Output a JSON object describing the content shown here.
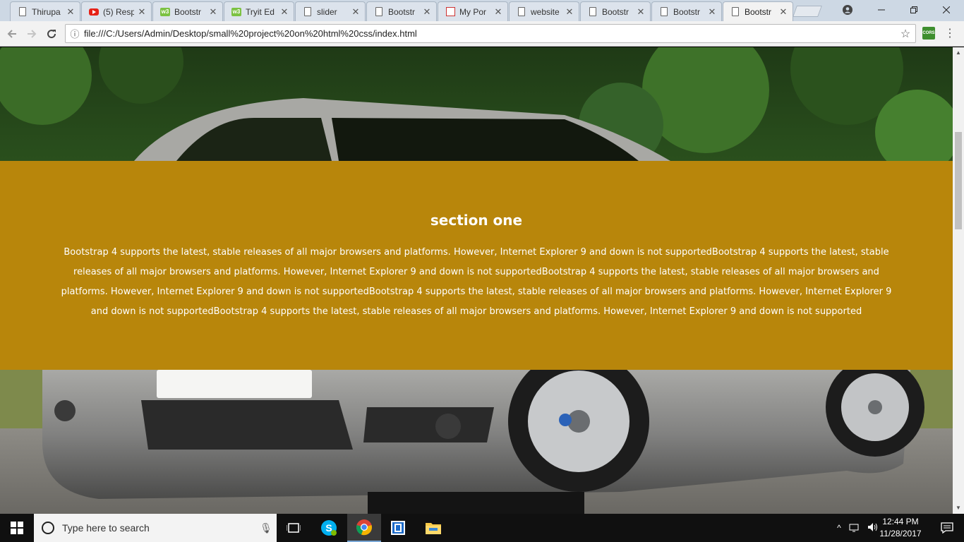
{
  "browser": {
    "tabs": [
      {
        "title": "Thirupa",
        "favicon": "doc-icon"
      },
      {
        "title": "(5) Resp",
        "favicon": "youtube-icon"
      },
      {
        "title": "Bootstr",
        "favicon": "w3-icon"
      },
      {
        "title": "Tryit Ed",
        "favicon": "w3-icon"
      },
      {
        "title": "slider",
        "favicon": "doc-icon"
      },
      {
        "title": "Bootstr",
        "favicon": "doc-icon"
      },
      {
        "title": "My Por",
        "favicon": "portfolio-icon"
      },
      {
        "title": "website",
        "favicon": "doc-icon"
      },
      {
        "title": "Bootstr",
        "favicon": "doc-icon"
      },
      {
        "title": "Bootstr",
        "favicon": "doc-icon"
      },
      {
        "title": "Bootstr",
        "favicon": "doc-icon",
        "active": true
      }
    ],
    "url": "file:///C:/Users/Admin/Desktop/small%20project%20on%20html%20css/index.html",
    "extension_label": "CORS"
  },
  "page": {
    "section_title": "section one",
    "section_text": "Bootstrap 4 supports the latest, stable releases of all major browsers and platforms. However, Internet Explorer 9 and down is not supportedBootstrap 4 supports the latest, stable releases of all major browsers and platforms. However, Internet Explorer 9 and down is not supportedBootstrap 4 supports the latest, stable releases of all major browsers and platforms. However, Internet Explorer 9 and down is not supportedBootstrap 4 supports the latest, stable releases of all major browsers and platforms. However, Internet Explorer 9 and down is not supportedBootstrap 4 supports the latest, stable releases of all major browsers and platforms. However, Internet Explorer 9 and down is not supported",
    "section_color": "#b8860b"
  },
  "taskbar": {
    "search_placeholder": "Type here to search",
    "time": "12:44 PM",
    "date": "11/28/2017"
  }
}
